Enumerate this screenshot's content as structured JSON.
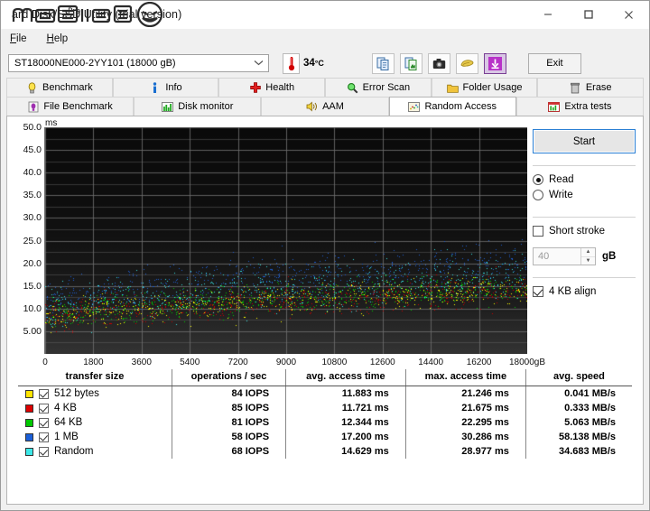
{
  "window": {
    "title": "HD Tune Pro - Hard Disk/SSD Utility (trial version)",
    "title_visible_suffix": "ard Disk/SSD Utility (trial version)",
    "watermark": "mobile01",
    "minimize": "minimize-icon",
    "maximize": "maximize-icon",
    "close": "close-icon"
  },
  "menu": {
    "items": [
      {
        "label": "File",
        "accel": "F"
      },
      {
        "label": "Help",
        "accel": "H"
      }
    ]
  },
  "toolbar": {
    "drive": "ST18000NE000-2YY101 (18000 gB)",
    "drive_chevron": "chevron-down-icon",
    "temperature_value": "34",
    "temperature_unit": "°C",
    "temperature_icon": "thermometer-icon",
    "buttons": [
      {
        "name": "copy-icon",
        "label": "Copy"
      },
      {
        "name": "copy-screenshot-icon",
        "label": "Copy screenshot"
      },
      {
        "name": "camera-icon",
        "label": "Save screenshot"
      },
      {
        "name": "hand-icon",
        "label": "Options"
      },
      {
        "name": "download-arrow-icon",
        "label": "Download"
      }
    ],
    "exit_label": "Exit"
  },
  "tabs": {
    "row1": [
      {
        "label": "Benchmark",
        "icon": "bulb-icon",
        "active": false
      },
      {
        "label": "Info",
        "icon": "info-icon",
        "active": false
      },
      {
        "label": "Health",
        "icon": "cross-icon",
        "active": false
      },
      {
        "label": "Error Scan",
        "icon": "magnifier-icon",
        "active": false
      },
      {
        "label": "Folder Usage",
        "icon": "folder-icon",
        "active": false
      },
      {
        "label": "Erase",
        "icon": "trash-icon",
        "active": false
      }
    ],
    "row2": [
      {
        "label": "File Benchmark",
        "icon": "file-benchmark-icon",
        "active": false
      },
      {
        "label": "Disk monitor",
        "icon": "bar-chart-icon",
        "active": false
      },
      {
        "label": "AAM",
        "icon": "speaker-icon",
        "active": false
      },
      {
        "label": "Random Access",
        "icon": "scatter-icon",
        "active": true
      },
      {
        "label": "Extra tests",
        "icon": "grid-chart-icon",
        "active": false
      }
    ]
  },
  "side_panel": {
    "start_label": "Start",
    "mode": {
      "read_label": "Read",
      "write_label": "Write",
      "selected": "Read"
    },
    "short_stroke": {
      "label": "Short stroke",
      "checked": false,
      "value": "40",
      "unit": "gB"
    },
    "align": {
      "label": "4 KB align",
      "checked": true
    }
  },
  "chart_data": {
    "type": "scatter",
    "title": "",
    "xlabel": "",
    "ylabel": "ms",
    "y_unit": "ms",
    "x_unit": "gB",
    "xlim": [
      0,
      18000
    ],
    "ylim": [
      0,
      50
    ],
    "grid": true,
    "legend_position": "table-below",
    "ytick_labels": [
      "50.0",
      "45.0",
      "40.0",
      "35.0",
      "30.0",
      "25.0",
      "20.0",
      "15.0",
      "10.0",
      "5.00"
    ],
    "yticks": [
      50,
      45,
      40,
      35,
      30,
      25,
      20,
      15,
      10,
      5
    ],
    "xtick_labels": [
      "0",
      "1800",
      "3600",
      "5400",
      "7200",
      "9000",
      "10800",
      "12600",
      "14400",
      "16200",
      "18000gB"
    ],
    "xticks": [
      0,
      1800,
      3600,
      5400,
      7200,
      9000,
      10800,
      12600,
      14400,
      16200,
      18000
    ],
    "background": "#101010",
    "gridline_color": "#6d6d6d",
    "series": [
      {
        "name": "512 bytes",
        "color": "#ffff00",
        "points": 620,
        "avg_ms": 11.883,
        "max_ms": 21.246
      },
      {
        "name": "4 KB",
        "color": "#cc0000",
        "points": 620,
        "avg_ms": 11.721,
        "max_ms": 21.675
      },
      {
        "name": "64 KB",
        "color": "#00cc00",
        "points": 620,
        "avg_ms": 12.344,
        "max_ms": 22.295
      },
      {
        "name": "1 MB",
        "color": "#1f5fd0",
        "points": 620,
        "avg_ms": 17.2,
        "max_ms": 30.286
      },
      {
        "name": "Random",
        "color": "#36e0e0",
        "points": 620,
        "avg_ms": 14.629,
        "max_ms": 28.977
      }
    ]
  },
  "results_table": {
    "columns": [
      "transfer size",
      "operations / sec",
      "avg. access time",
      "max. access time",
      "avg. speed"
    ],
    "rows": [
      {
        "color": "#ffe400",
        "checked": true,
        "transfer_size": "512 bytes",
        "iops": "84 IOPS",
        "avg_access": "11.883 ms",
        "max_access": "21.246 ms",
        "avg_speed": "0.041 MB/s"
      },
      {
        "color": "#dd0000",
        "checked": true,
        "transfer_size": "4 KB",
        "iops": "85 IOPS",
        "avg_access": "11.721 ms",
        "max_access": "21.675 ms",
        "avg_speed": "0.333 MB/s"
      },
      {
        "color": "#00c800",
        "checked": true,
        "transfer_size": "64 KB",
        "iops": "81 IOPS",
        "avg_access": "12.344 ms",
        "max_access": "22.295 ms",
        "avg_speed": "5.063 MB/s"
      },
      {
        "color": "#1a5fd8",
        "checked": true,
        "transfer_size": "1 MB",
        "iops": "58 IOPS",
        "avg_access": "17.200 ms",
        "max_access": "30.286 ms",
        "avg_speed": "58.138 MB/s"
      },
      {
        "color": "#3ce8e8",
        "checked": true,
        "transfer_size": "Random",
        "iops": "68 IOPS",
        "avg_access": "14.629 ms",
        "max_access": "28.977 ms",
        "avg_speed": "34.683 MB/s"
      }
    ]
  }
}
